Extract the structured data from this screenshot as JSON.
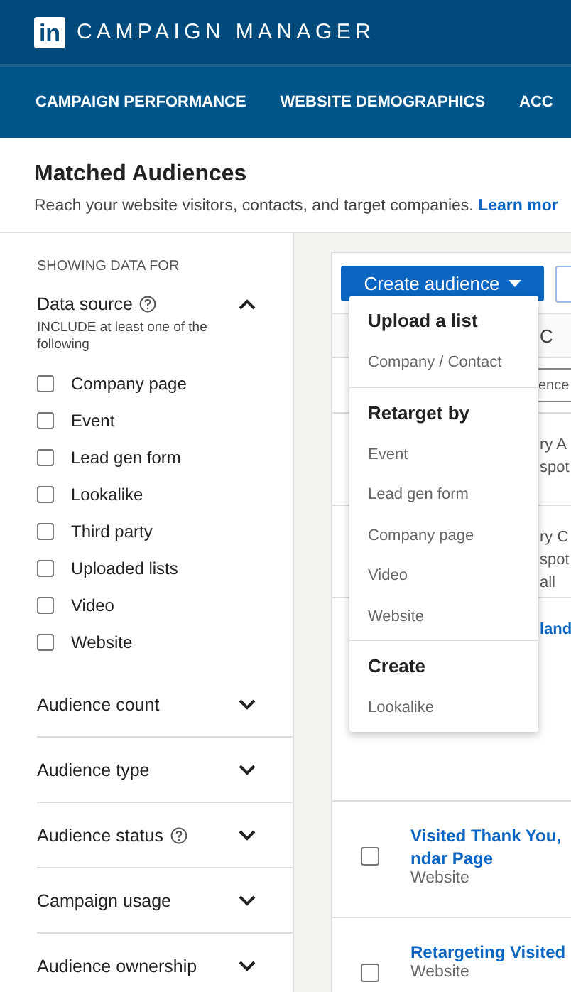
{
  "header": {
    "logo": "in",
    "title": "CAMPAIGN MANAGER"
  },
  "nav": [
    {
      "label": "CAMPAIGN PERFORMANCE"
    },
    {
      "label": "WEBSITE DEMOGRAPHICS"
    },
    {
      "label": "ACC"
    }
  ],
  "page": {
    "title": "Matched Audiences",
    "subtitle": "Reach your website visitors, contacts, and target companies. ",
    "link": "Learn mor"
  },
  "sidebar": {
    "caption": "SHOWING DATA FOR",
    "filter": {
      "label": "Data source",
      "help": true,
      "expanded": true,
      "hint": "INCLUDE at least one of the following",
      "options": [
        {
          "label": "Company page",
          "checked": false
        },
        {
          "label": "Event",
          "checked": false
        },
        {
          "label": "Lead gen form",
          "checked": false
        },
        {
          "label": "Lookalike",
          "checked": false
        },
        {
          "label": "Third party",
          "checked": false
        },
        {
          "label": "Uploaded lists",
          "checked": false
        },
        {
          "label": "Video",
          "checked": false
        },
        {
          "label": "Website",
          "checked": false
        }
      ]
    },
    "sections": [
      {
        "label": "Audience count",
        "help": false,
        "expanded": false
      },
      {
        "label": "Audience type",
        "help": false,
        "expanded": false
      },
      {
        "label": "Audience status",
        "help": true,
        "expanded": false
      },
      {
        "label": "Campaign usage",
        "help": false,
        "expanded": false
      },
      {
        "label": "Audience ownership",
        "help": false,
        "expanded": false
      }
    ]
  },
  "table": {
    "create_button": "Create audience",
    "header_fragment": "C",
    "search_fragment": "ence",
    "rows": [
      {
        "kind": "covered",
        "fragments": [
          {
            "text": "ry A",
            "kind": "text"
          },
          {
            "text": "spot",
            "kind": "text"
          }
        ]
      },
      {
        "kind": "covered",
        "fragments": [
          {
            "text": "ry C",
            "kind": "text"
          },
          {
            "text": "spot",
            "kind": "text"
          },
          {
            "text": "all",
            "kind": "text"
          }
        ]
      },
      {
        "kind": "covered",
        "fragments": [
          {
            "text": "land",
            "kind": "link"
          }
        ]
      },
      {
        "kind": "full",
        "checked": false,
        "title_lines": [
          "Visited Thank You,",
          "ndar Page"
        ],
        "subtitle": "Website"
      },
      {
        "kind": "full",
        "checked": false,
        "title_lines": [
          "Retargeting Visited "
        ],
        "subtitle": "Website"
      }
    ]
  },
  "menu": {
    "groups": [
      {
        "heading": "Upload a list",
        "items": [
          "Company / Contact"
        ]
      },
      {
        "heading": "Retarget by",
        "items": [
          "Event",
          "Lead gen form",
          "Company page",
          "Video",
          "Website"
        ]
      },
      {
        "heading": "Create",
        "items": [
          "Lookalike"
        ]
      }
    ]
  }
}
